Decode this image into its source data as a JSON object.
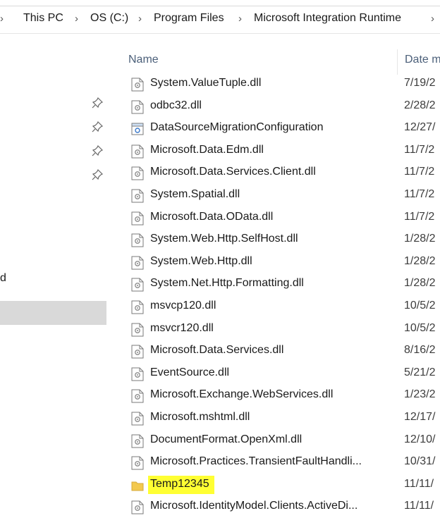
{
  "breadcrumb": {
    "leading_separator": "›",
    "items": [
      "This PC",
      "OS (C:)",
      "Program Files",
      "Microsoft Integration Runtime"
    ],
    "separator": "›"
  },
  "nav": {
    "pinned_count_icon": "pin-icon",
    "partial_text": "d"
  },
  "columns": {
    "name": "Name",
    "date": "Date m"
  },
  "files": [
    {
      "name": "System.ValueTuple.dll",
      "date": "7/19/2",
      "icon": "dll-icon"
    },
    {
      "name": "odbc32.dll",
      "date": "2/28/2",
      "icon": "dll-icon"
    },
    {
      "name": "DataSourceMigrationConfiguration",
      "date": "12/27/",
      "icon": "config-icon"
    },
    {
      "name": "Microsoft.Data.Edm.dll",
      "date": "11/7/2",
      "icon": "dll-icon"
    },
    {
      "name": "Microsoft.Data.Services.Client.dll",
      "date": "11/7/2",
      "icon": "dll-icon"
    },
    {
      "name": "System.Spatial.dll",
      "date": "11/7/2",
      "icon": "dll-icon"
    },
    {
      "name": "Microsoft.Data.OData.dll",
      "date": "11/7/2",
      "icon": "dll-icon"
    },
    {
      "name": "System.Web.Http.SelfHost.dll",
      "date": "1/28/2",
      "icon": "dll-icon"
    },
    {
      "name": "System.Web.Http.dll",
      "date": "1/28/2",
      "icon": "dll-icon"
    },
    {
      "name": "System.Net.Http.Formatting.dll",
      "date": "1/28/2",
      "icon": "dll-icon"
    },
    {
      "name": "msvcp120.dll",
      "date": "10/5/2",
      "icon": "dll-icon"
    },
    {
      "name": "msvcr120.dll",
      "date": "10/5/2",
      "icon": "dll-icon"
    },
    {
      "name": "Microsoft.Data.Services.dll",
      "date": "8/16/2",
      "icon": "dll-icon"
    },
    {
      "name": "EventSource.dll",
      "date": "5/21/2",
      "icon": "dll-icon"
    },
    {
      "name": "Microsoft.Exchange.WebServices.dll",
      "date": "1/23/2",
      "icon": "dll-icon"
    },
    {
      "name": "Microsoft.mshtml.dll",
      "date": "12/17/",
      "icon": "dll-icon"
    },
    {
      "name": "DocumentFormat.OpenXml.dll",
      "date": "12/10/",
      "icon": "dll-icon"
    },
    {
      "name": "Microsoft.Practices.TransientFaultHandli...",
      "date": "10/31/",
      "icon": "dll-icon"
    },
    {
      "name": "Temp12345",
      "date": "11/11/",
      "icon": "folder-icon",
      "highlighted": true
    },
    {
      "name": "Microsoft.IdentityModel.Clients.ActiveDi...",
      "date": "11/11/",
      "icon": "dll-icon"
    }
  ],
  "colors": {
    "highlight": "#ffff33",
    "folder": "#f3c94e",
    "selection": "#d9d9d9"
  }
}
